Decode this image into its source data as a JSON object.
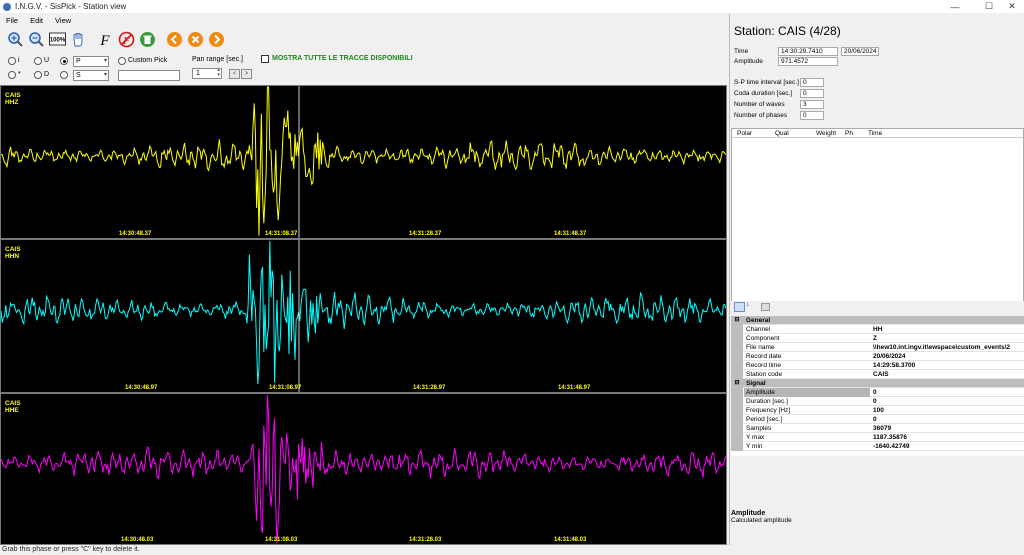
{
  "window": {
    "title": "I.N.G.V. - SisPick - Station view",
    "minimize": "—",
    "maximize": "☐",
    "close": "✕"
  },
  "menu": {
    "file": "File",
    "edit": "Edit",
    "view": "View"
  },
  "toolbar": {
    "zoom100": "100%"
  },
  "controls": {
    "polarity_i": "i",
    "polarity_u": "U",
    "polarity_star": "*",
    "polarity_d": "D",
    "phase_p": "P",
    "phase_s": "S",
    "custom_pick_label": "Custom Pick",
    "pan_range_label": "Pan range [sec.]",
    "pan_range_value": "1",
    "prev": "<",
    "next": ">",
    "show_all_label": "MOSTRA TUTTE LE TRACCE DISPONIBILI"
  },
  "traces": [
    {
      "station": "CAIS",
      "channel": "HHZ",
      "color": "#ffff00",
      "ticks": [
        "14:30:48.37",
        "14:31:08.37",
        "14:31:28.37",
        "14:31:48.37"
      ]
    },
    {
      "station": "CAIS",
      "channel": "HHN",
      "color": "#00ffff",
      "ticks": [
        "14:30:48.97",
        "14:31:08.97",
        "14:31:28.97",
        "14:31:48.97"
      ]
    },
    {
      "station": "CAIS",
      "channel": "HHE",
      "color": "#ff00ff",
      "ticks": [
        "14:30:48.03",
        "14:31:08.03",
        "14:31:28.03",
        "14:31:48.03"
      ]
    }
  ],
  "status": "Grab this phase or press \"C\" key to delete it.",
  "station_panel": {
    "title": "Station: CAIS (4/28)",
    "time_label": "Time",
    "time_value": "14:30:29.7410",
    "date_value": "20/06/2024",
    "amplitude_label": "Amplitude",
    "amplitude_value": "971.4572",
    "sp_label": "S-P time interval [sec.]",
    "sp_value": "0",
    "coda_label": "Coda duration [sec.]",
    "coda_value": "0",
    "waves_label": "Number of waves",
    "waves_value": "3",
    "phases_label": "Number of phases",
    "phases_value": "0",
    "table_headers": [
      "Polar",
      "Qual",
      "Weight",
      "Ph",
      "Time"
    ]
  },
  "properties": {
    "general_label": "General",
    "general": [
      {
        "k": "Channel",
        "v": "HH"
      },
      {
        "k": "Component",
        "v": "Z"
      },
      {
        "k": "File name",
        "v": "\\\\hew10.int.ingv.it\\ewspace\\custom_events\\2"
      },
      {
        "k": "Record date",
        "v": "20/06/2024"
      },
      {
        "k": "Record time",
        "v": "14:29:58.3700"
      },
      {
        "k": "Station code",
        "v": "CAIS"
      }
    ],
    "signal_label": "Signal",
    "signal": [
      {
        "k": "Amplitude",
        "v": "0"
      },
      {
        "k": "Duration [sec.]",
        "v": "0"
      },
      {
        "k": "Frequency [Hz]",
        "v": "100"
      },
      {
        "k": "Period [sec.]",
        "v": "0"
      },
      {
        "k": "Samples",
        "v": "36079"
      },
      {
        "k": "Y max",
        "v": "1187.35876"
      },
      {
        "k": "Y min",
        "v": "-1640.42749"
      }
    ],
    "desc_title": "Amplitude",
    "desc_text": "Calculated amplitude"
  }
}
